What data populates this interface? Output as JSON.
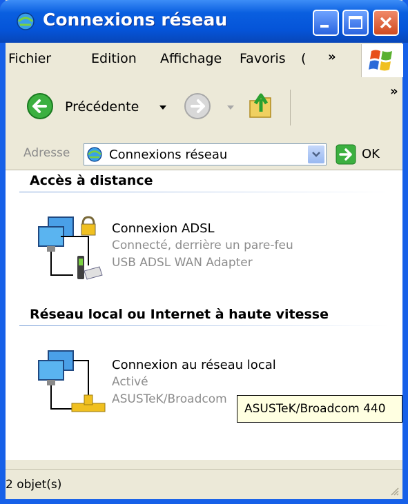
{
  "window": {
    "title": "Connexions réseau",
    "icon": "network-connections-icon",
    "controls": [
      "minimize",
      "maximize",
      "close"
    ]
  },
  "menubar": {
    "items": [
      "Fichier",
      "Edition",
      "Affichage",
      "Favoris",
      "("
    ],
    "overflow": "»"
  },
  "toolbar": {
    "back_label": "Précédente",
    "overflow": "»"
  },
  "address": {
    "label": "Adresse",
    "value": "Connexions réseau",
    "go_label": "OK"
  },
  "groups": [
    {
      "title": "Accès à distance",
      "items": [
        {
          "name": "Connexion ADSL",
          "status": "Connecté, derrière un pare-feu",
          "device": "USB ADSL WAN Adapter"
        }
      ]
    },
    {
      "title": "Réseau local ou Internet à haute vitesse",
      "items": [
        {
          "name": "Connexion au réseau local",
          "status": "Activé",
          "device": "ASUSTeK/Broadcom"
        }
      ]
    }
  ],
  "tooltip": "ASUSTeK/Broadcom 440",
  "status": {
    "text": "2 objet(s)"
  },
  "colors": {
    "titlebar": "#0554d8",
    "chrome": "#ece9d8",
    "group_line": "#7aa0d8",
    "sub_text": "#8c8c8c",
    "tooltip_bg": "#ffffe1"
  }
}
